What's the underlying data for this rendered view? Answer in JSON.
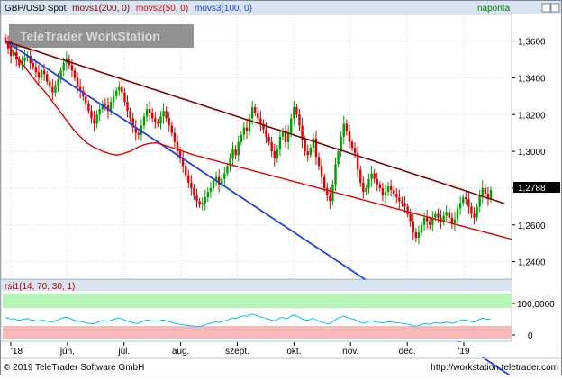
{
  "header": {
    "series_label": "GBP/USD Spot",
    "indicators": [
      "movs1(200, 0)",
      "movs2(50, 0)",
      "movs3(100, 0)"
    ],
    "period": "naponta"
  },
  "watermark": "TeleTrader WorkStation",
  "last_price_label": "1,2788",
  "rsi_header": "rsi1(14, 70, 30, 1)",
  "footer": {
    "copyright": "© 2019 TeleTrader Software GmbH",
    "url": "http://workstation.teletrader.com"
  },
  "colors": {
    "bull": "#00a000",
    "bear": "#e00000",
    "ma200": "#800000",
    "ma50": "#e00000",
    "ma100": "#2040e0",
    "rsi": "#00c8e8",
    "overbought_band": "#b8f5b8",
    "oversold_band": "#f8b8b8",
    "header_bar": "#d8e4f0"
  },
  "chart_data": [
    {
      "type": "candlestick",
      "title": "GBP/USD Spot",
      "x_tick_labels": [
        "'18",
        "jún.",
        "júl.",
        "aug.",
        "szept.",
        "okt.",
        "nov.",
        "dec.",
        "'19"
      ],
      "y_tick_labels": [
        "1,3600",
        "1,3400",
        "1,3200",
        "1,3000",
        "1,2800",
        "1,2600",
        "1,2400"
      ],
      "y_ticks": [
        1.36,
        1.34,
        1.32,
        1.3,
        1.28,
        1.26,
        1.24
      ],
      "ylim": [
        1.2305,
        1.3745
      ],
      "grid": true,
      "candles_start": "2018-05-03",
      "closes": [
        1.36,
        1.356,
        1.352,
        1.354,
        1.35,
        1.347,
        1.349,
        1.351,
        1.352,
        1.348,
        1.346,
        1.343,
        1.34,
        1.344,
        1.342,
        1.338,
        1.335,
        1.332,
        1.336,
        1.339,
        1.344,
        1.348,
        1.35,
        1.347,
        1.344,
        1.34,
        1.335,
        1.333,
        1.33,
        1.326,
        1.322,
        1.318,
        1.315,
        1.32,
        1.323,
        1.326,
        1.325,
        1.322,
        1.327,
        1.33,
        1.333,
        1.335,
        1.332,
        1.327,
        1.322,
        1.318,
        1.313,
        1.31,
        1.309,
        1.314,
        1.319,
        1.323,
        1.321,
        1.318,
        1.316,
        1.315,
        1.319,
        1.322,
        1.318,
        1.314,
        1.31,
        1.305,
        1.3,
        1.296,
        1.292,
        1.287,
        1.283,
        1.28,
        1.276,
        1.273,
        1.271,
        1.272,
        1.275,
        1.278,
        1.28,
        1.284,
        1.286,
        1.282,
        1.285,
        1.288,
        1.292,
        1.296,
        1.301,
        1.298,
        1.305,
        1.309,
        1.313,
        1.311,
        1.318,
        1.324,
        1.321,
        1.318,
        1.315,
        1.312,
        1.308,
        1.305,
        1.3,
        1.296,
        1.301,
        1.308,
        1.311,
        1.305,
        1.31,
        1.318,
        1.324,
        1.32,
        1.314,
        1.306,
        1.3,
        1.298,
        1.302,
        1.307,
        1.297,
        1.292,
        1.286,
        1.28,
        1.276,
        1.273,
        1.282,
        1.293,
        1.3,
        1.308,
        1.315,
        1.311,
        1.305,
        1.302,
        1.299,
        1.29,
        1.283,
        1.278,
        1.28,
        1.285,
        1.288,
        1.285,
        1.282,
        1.28,
        1.276,
        1.278,
        1.281,
        1.279,
        1.277,
        1.275,
        1.273,
        1.272,
        1.27,
        1.266,
        1.262,
        1.256,
        1.253,
        1.256,
        1.26,
        1.264,
        1.262,
        1.26,
        1.264,
        1.266,
        1.264,
        1.262,
        1.265,
        1.267,
        1.264,
        1.261,
        1.263,
        1.269,
        1.272,
        1.275,
        1.274,
        1.27,
        1.266,
        1.264,
        1.27,
        1.276,
        1.28,
        1.277,
        1.274,
        1.279
      ],
      "ma200": [
        1.36,
        1.3595,
        1.359,
        1.3585,
        1.358,
        1.3575,
        1.357,
        1.3565,
        1.3561,
        1.3556,
        1.3551,
        1.3546,
        1.3541,
        1.3536,
        1.3531,
        1.3526,
        1.3521,
        1.3516,
        1.3511,
        1.3506,
        1.3502,
        1.3497,
        1.3492,
        1.3487,
        1.3482,
        1.3477,
        1.3472,
        1.3467,
        1.3462,
        1.3457,
        1.3452,
        1.3448,
        1.3443,
        1.3438,
        1.3433,
        1.3428,
        1.3423,
        1.3418,
        1.3413,
        1.3408,
        1.3403,
        1.3398,
        1.3394,
        1.3389,
        1.3384,
        1.3379,
        1.3374,
        1.3369,
        1.3364,
        1.3359,
        1.3354,
        1.3349,
        1.3344,
        1.3339,
        1.3335,
        1.333,
        1.3325,
        1.332,
        1.3315,
        1.331,
        1.3305,
        1.33,
        1.3295,
        1.329,
        1.3285,
        1.3281,
        1.3276,
        1.3271,
        1.3266,
        1.3261,
        1.3256,
        1.3251,
        1.3246,
        1.3241,
        1.3236,
        1.3231,
        1.3227,
        1.3222,
        1.3217,
        1.3212,
        1.3207,
        1.3202,
        1.3197,
        1.3192,
        1.3187,
        1.3182,
        1.3177,
        1.3173,
        1.3168,
        1.3163,
        1.3158,
        1.3153,
        1.3148,
        1.3143,
        1.3138,
        1.3133,
        1.3128,
        1.3123,
        1.3119,
        1.3114,
        1.3109,
        1.3104,
        1.3099,
        1.3094,
        1.3089,
        1.3084,
        1.3079,
        1.3074,
        1.3069,
        1.3065,
        1.306,
        1.3055,
        1.305,
        1.3045,
        1.304,
        1.3035,
        1.303,
        1.3025,
        1.302,
        1.3015,
        1.3011,
        1.3006,
        1.3001,
        1.2996,
        1.2991,
        1.2986,
        1.2981,
        1.2976,
        1.2971,
        1.2966,
        1.2961,
        1.2957,
        1.2952,
        1.2947,
        1.2942,
        1.2937,
        1.2932,
        1.2927,
        1.2922,
        1.2917,
        1.2912,
        1.2907,
        1.2903,
        1.2898,
        1.2893,
        1.2888,
        1.2883,
        1.2878,
        1.2873,
        1.2868,
        1.2863,
        1.2858,
        1.2853,
        1.2849,
        1.2844,
        1.2839,
        1.2834,
        1.2829,
        1.2824,
        1.2819,
        1.2814,
        1.2809,
        1.2804,
        1.2799,
        1.2795,
        1.279,
        1.2785,
        1.278,
        1.2775,
        1.277,
        1.2765,
        1.276,
        1.2755,
        1.275,
        1.2745,
        1.2741,
        1.2736,
        1.2731,
        1.2726,
        1.2721,
        1.2716
      ],
      "ma50": [
        1.36,
        1.358,
        1.356,
        1.354,
        1.352,
        1.35,
        1.348,
        1.346,
        1.344,
        1.342,
        1.34,
        1.338,
        1.336,
        1.3345,
        1.333,
        1.331,
        1.329,
        1.327,
        1.325,
        1.323,
        1.321,
        1.319,
        1.317,
        1.315,
        1.313,
        1.311,
        1.3095,
        1.308,
        1.3065,
        1.305,
        1.304,
        1.303,
        1.3022,
        1.3015,
        1.3008,
        1.3,
        1.2995,
        1.299,
        1.2986,
        1.2983,
        1.298,
        1.2982,
        1.2985,
        1.299,
        1.2995,
        1.3,
        1.3008,
        1.3016,
        1.3024,
        1.303,
        1.3036,
        1.304,
        1.3043,
        1.3045,
        1.3046,
        1.3044,
        1.304,
        1.3035,
        1.303,
        1.3025,
        1.302,
        1.3015,
        1.301,
        1.3005,
        1.3,
        1.2995,
        1.299,
        1.2985,
        1.298,
        1.2976,
        1.2972,
        1.2968,
        1.2964,
        1.296,
        1.2956,
        1.2952,
        1.2948,
        1.2944,
        1.294,
        1.2936,
        1.2932,
        1.2928,
        1.2924,
        1.292,
        1.2916,
        1.2912,
        1.2908,
        1.2904,
        1.29,
        1.2896,
        1.2892,
        1.2888,
        1.2884,
        1.288,
        1.2876,
        1.2872,
        1.2868,
        1.2864,
        1.286,
        1.2856,
        1.2852,
        1.2848,
        1.2844,
        1.284,
        1.2836,
        1.2832,
        1.2828,
        1.2824,
        1.282,
        1.2816,
        1.2812,
        1.2808,
        1.2804,
        1.28,
        1.2796,
        1.2792,
        1.2788,
        1.2784,
        1.278,
        1.2776,
        1.2772,
        1.2768,
        1.2764,
        1.276,
        1.2756,
        1.2752,
        1.2748,
        1.2744,
        1.274,
        1.2736,
        1.2732,
        1.2728,
        1.2724,
        1.272,
        1.2716,
        1.2712,
        1.2708,
        1.2704,
        1.27,
        1.2696,
        1.2692,
        1.2688,
        1.2684,
        1.268,
        1.2676,
        1.2672,
        1.2668,
        1.2664,
        1.266,
        1.2656,
        1.2652,
        1.2648,
        1.2644,
        1.264,
        1.2636,
        1.2632,
        1.2628,
        1.2624,
        1.262,
        1.2616,
        1.2612,
        1.2608,
        1.2604,
        1.26,
        1.2596,
        1.2592,
        1.2588,
        1.2584,
        1.258,
        1.2576,
        1.2572,
        1.2568,
        1.2564,
        1.256,
        1.2556,
        1.2552,
        1.2548,
        1.2544,
        1.254,
        1.2536,
        1.2532,
        1.2528,
        1.2524,
        1.252,
        1.2516,
        1.2512
      ],
      "ma100": [
        1.36,
        1.359,
        1.358,
        1.357,
        1.356,
        1.355,
        1.354,
        1.353,
        1.352,
        1.351,
        1.35,
        1.349,
        1.348,
        1.347,
        1.346,
        1.345,
        1.344,
        1.343,
        1.342,
        1.341,
        1.34,
        1.339,
        1.338,
        1.337,
        1.336,
        1.335,
        1.334,
        1.333,
        1.332,
        1.331,
        1.33,
        1.329,
        1.328,
        1.327,
        1.326,
        1.325,
        1.324,
        1.323,
        1.322,
        1.321,
        1.32,
        1.319,
        1.318,
        1.317,
        1.316,
        1.315,
        1.314,
        1.313,
        1.312,
        1.311,
        1.31,
        1.309,
        1.308,
        1.307,
        1.306,
        1.305,
        1.304,
        1.303,
        1.302,
        1.301,
        1.3,
        1.299,
        1.298,
        1.297,
        1.296,
        1.295,
        1.294,
        1.293,
        1.292,
        1.291,
        1.29,
        1.289,
        1.288,
        1.287,
        1.286,
        1.285,
        1.284,
        1.283,
        1.282,
        1.281,
        1.28,
        1.279,
        1.278,
        1.277,
        1.276,
        1.275,
        1.274,
        1.273,
        1.272,
        1.271,
        1.27,
        1.269,
        1.268,
        1.267,
        1.266,
        1.265,
        1.264,
        1.263,
        1.262,
        1.261,
        1.26,
        1.259,
        1.258,
        1.257,
        1.256,
        1.255,
        1.254,
        1.253,
        1.252,
        1.251,
        1.25,
        1.249,
        1.248,
        1.247,
        1.246,
        1.245,
        1.244,
        1.243,
        1.242,
        1.241,
        1.24,
        1.239,
        1.238,
        1.237,
        1.236,
        1.235,
        1.234,
        1.233,
        1.232,
        1.231,
        1.23,
        1.229,
        1.228,
        1.227,
        1.226,
        1.225,
        1.224,
        1.223,
        1.222,
        1.221,
        1.22,
        1.219,
        1.218,
        1.217,
        1.216,
        1.215,
        1.214,
        1.213,
        1.212,
        1.211,
        1.21,
        1.209,
        1.208,
        1.207,
        1.206,
        1.205,
        1.204,
        1.203,
        1.202,
        1.201,
        1.2,
        1.199,
        1.198,
        1.197,
        1.196,
        1.195,
        1.194,
        1.193,
        1.192,
        1.191,
        1.19,
        1.189,
        1.188,
        1.187,
        1.186,
        1.185,
        1.184,
        1.183,
        1.182,
        1.181,
        1.18,
        1.179,
        1.178,
        1.177,
        1.176,
        1.175,
        1.174,
        1.173
      ]
    },
    {
      "type": "line",
      "title": "rsi1(14, 70, 30, 1)",
      "y_tick_labels": [
        "100,0000",
        "0"
      ],
      "ylim": [
        0,
        100
      ],
      "overbought": 70,
      "oversold": 30,
      "values": [
        55,
        53,
        50,
        52,
        48,
        46,
        49,
        51,
        52,
        48,
        47,
        45,
        43,
        47,
        46,
        44,
        42,
        40,
        45,
        48,
        52,
        55,
        56,
        53,
        50,
        47,
        44,
        43,
        41,
        39,
        37,
        36,
        35,
        40,
        43,
        46,
        45,
        43,
        47,
        50,
        52,
        54,
        51,
        47,
        44,
        42,
        39,
        37,
        37,
        41,
        45,
        48,
        47,
        45,
        44,
        43,
        46,
        48,
        45,
        42,
        40,
        37,
        35,
        33,
        32,
        31,
        30,
        29,
        28,
        27,
        27,
        29,
        32,
        35,
        37,
        40,
        42,
        39,
        42,
        45,
        48,
        51,
        54,
        51,
        56,
        58,
        61,
        59,
        63,
        66,
        63,
        60,
        57,
        55,
        52,
        50,
        47,
        45,
        49,
        54,
        56,
        51,
        54,
        60,
        63,
        60,
        56,
        51,
        48,
        47,
        50,
        53,
        47,
        44,
        41,
        38,
        36,
        35,
        42,
        49,
        53,
        57,
        60,
        57,
        53,
        51,
        49,
        44,
        40,
        37,
        39,
        43,
        45,
        43,
        41,
        40,
        38,
        40,
        42,
        41,
        40,
        39,
        38,
        37,
        36,
        34,
        32,
        29,
        28,
        30,
        33,
        36,
        35,
        34,
        37,
        39,
        38,
        37,
        39,
        41,
        39,
        37,
        38,
        43,
        46,
        48,
        47,
        45,
        42,
        41,
        45,
        50,
        53,
        51,
        49,
        52
      ]
    }
  ]
}
